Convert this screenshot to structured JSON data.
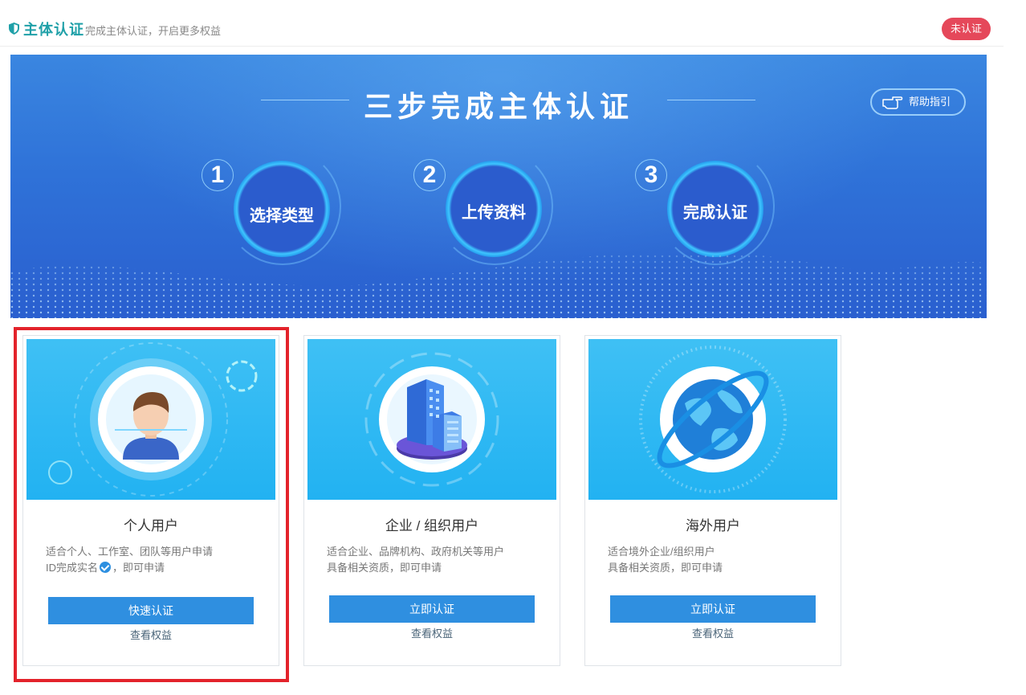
{
  "header": {
    "title": "主体认证",
    "subtitle": "完成主体认证，开启更多权益",
    "status_badge": "未认证"
  },
  "banner": {
    "headline": "三步完成主体认证",
    "help_label": "帮助指引",
    "steps": [
      {
        "number": "1",
        "label": "选择类型"
      },
      {
        "number": "2",
        "label": "上传资料"
      },
      {
        "number": "3",
        "label": "完成认证"
      }
    ]
  },
  "cards": [
    {
      "name": "个人用户",
      "desc_line1": "适合个人、工作室、团队等用户申请",
      "desc_line2_pre": "ID完成实名",
      "desc_line2_post": "，即可申请",
      "button": "快速认证",
      "link": "查看权益",
      "selected": true,
      "icon": "person-face-scan-icon"
    },
    {
      "name": "企业 / 组织用户",
      "desc_line1": "适合企业、品牌机构、政府机关等用户",
      "desc_line2": "具备相关资质，即可申请",
      "button": "立即认证",
      "link": "查看权益",
      "icon": "building-icon"
    },
    {
      "name": "海外用户",
      "desc_line1": "适合境外企业/组织用户",
      "desc_line2": "具备相关资质，即可申请",
      "button": "立即认证",
      "link": "查看权益",
      "icon": "globe-icon"
    }
  ],
  "colors": {
    "brand_teal": "#1fa0a8",
    "badge_red": "#e5485a",
    "button_blue": "#2f8fe0",
    "selected_border": "#e3232b"
  }
}
